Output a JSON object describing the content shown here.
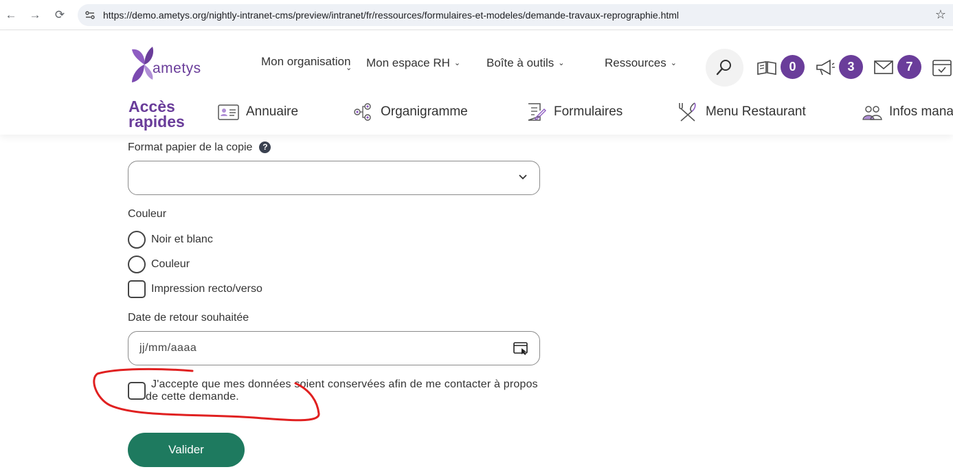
{
  "browser": {
    "url": "https://demo.ametys.org/nightly-intranet-cms/preview/intranet/fr/ressources/formulaires-et-modeles/demande-travaux-reprographie.html"
  },
  "header": {
    "logo_text": "ametys",
    "nav": [
      {
        "label": "Mon organisation"
      },
      {
        "label": "Mon espace RH"
      },
      {
        "label": "Boîte à outils"
      },
      {
        "label": "Ressources"
      }
    ],
    "badges": {
      "news": "0",
      "announcements": "3",
      "messages": "7"
    },
    "accent_color": "#6a3d9a"
  },
  "quick_access": {
    "title_line1": "Accès",
    "title_line2": "rapides",
    "items": [
      {
        "label": "Annuaire",
        "icon": "contact-card-icon"
      },
      {
        "label": "Organigramme",
        "icon": "org-chart-icon"
      },
      {
        "label": "Formulaires",
        "icon": "form-icon"
      },
      {
        "label": "Menu Restaurant",
        "icon": "utensils-icon"
      },
      {
        "label": "Infos mana",
        "icon": "managers-icon"
      }
    ]
  },
  "form": {
    "paper_format_label": "Format papier de la copie",
    "paper_format_value": "",
    "help_symbol": "?",
    "color_label": "Couleur",
    "options": [
      {
        "label": "Noir et blanc",
        "type": "radio",
        "checked": false
      },
      {
        "label": "Couleur",
        "type": "radio",
        "checked": false
      },
      {
        "label": "Impression recto/verso",
        "type": "checkbox",
        "checked": false
      }
    ],
    "date_label": "Date de retour souhaitée",
    "date_placeholder": "jj/mm/aaaa",
    "consent_text": "J'accepte que mes données soient conservées afin de me contacter à propos de cette demande.",
    "submit_label": "Valider",
    "submit_color": "#1e7a5f",
    "annotation_color": "#e02020"
  }
}
